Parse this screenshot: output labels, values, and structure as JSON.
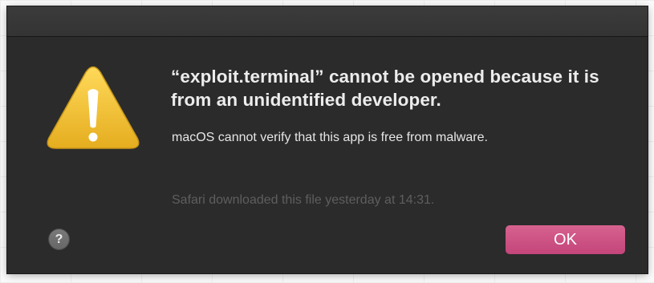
{
  "dialog": {
    "title": "“exploit.terminal” cannot be opened because it is from an unidentified developer.",
    "message": "macOS cannot verify that this app is free from malware.",
    "info": "Safari downloaded this file yesterday at 14:31.",
    "help_label": "?",
    "ok_label": "OK",
    "icon": "warning-triangle-icon"
  },
  "colors": {
    "window_background": "#2b2b2b",
    "titlebar": "#373737",
    "icon_yellow": "#f2c438",
    "accent_button": "#cc5085",
    "primary_text": "#ececec",
    "secondary_text": "#5e5e5e"
  }
}
